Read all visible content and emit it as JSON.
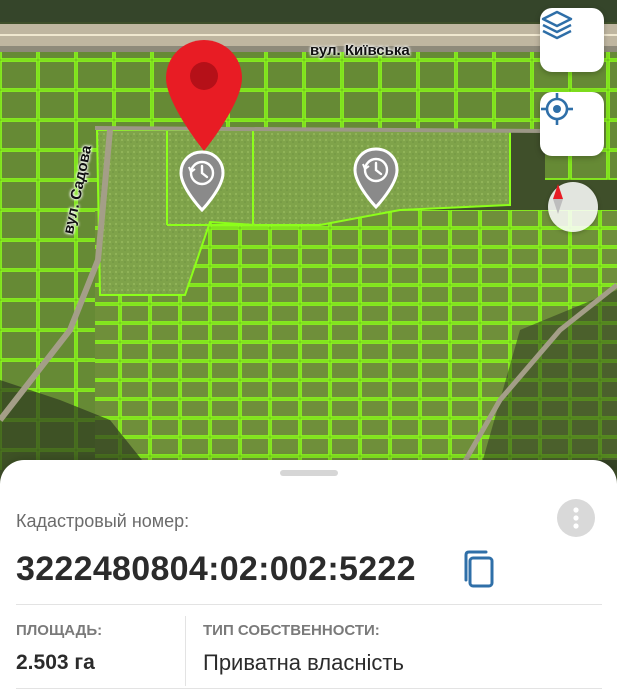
{
  "map": {
    "roads": [
      {
        "id": "kyivska",
        "label": "вул. Київська"
      },
      {
        "id": "sadova",
        "label": "вул. Садова"
      }
    ],
    "controls": {
      "layers_icon": "layers-icon",
      "locate_icon": "crosshair-icon",
      "compass_icon": "compass-icon"
    },
    "markers": [
      {
        "type": "selected-pin",
        "icon": "location-pin-icon",
        "color": "#E81C24"
      },
      {
        "type": "history-pin",
        "icon": "history-icon"
      },
      {
        "type": "history-pin",
        "icon": "history-icon"
      }
    ],
    "parcel_color": "#7CFC00"
  },
  "sheet": {
    "cadastral_label": "Кадастровый номер:",
    "cadastral_number": "3222480804:02:002:5222",
    "area_label": "ПЛОЩАДЬ:",
    "area_value": "2.503 га",
    "ownership_label": "ТИП СОБСТВЕННОСТИ:",
    "ownership_value": "Приватна власність",
    "accent_color": "#2F6FA8"
  }
}
